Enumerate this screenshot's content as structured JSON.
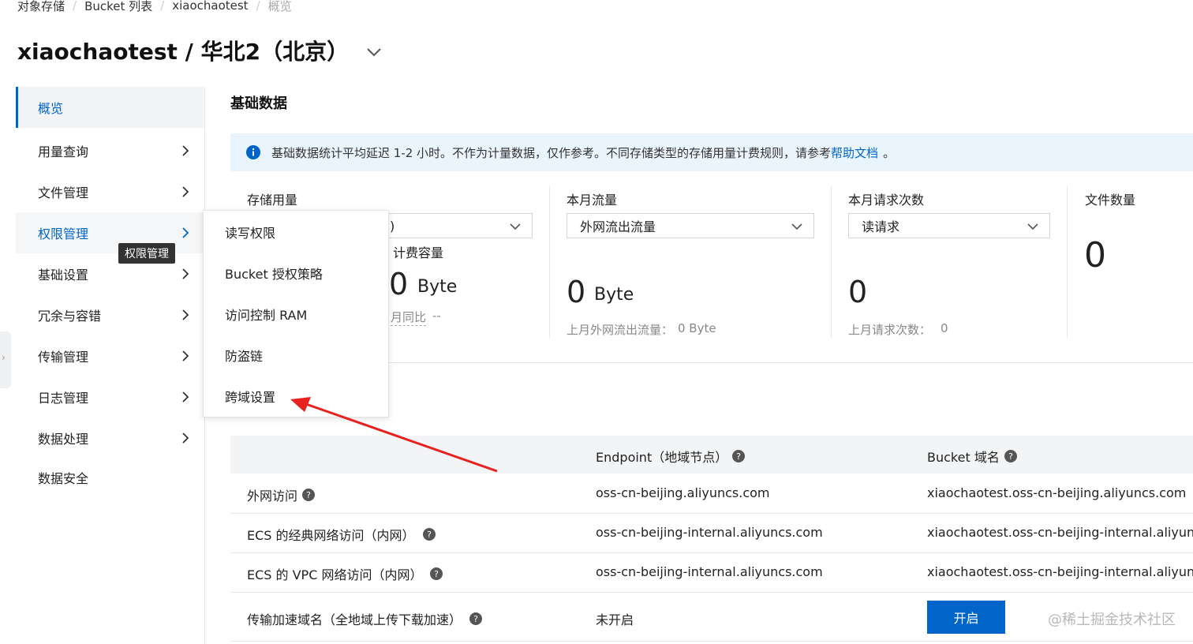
{
  "breadcrumb": [
    "对象存储",
    "Bucket 列表",
    "xiaochaotest",
    "概览"
  ],
  "title": "xiaochaotest / 华北2（北京）",
  "sidebar": {
    "items": [
      {
        "label": "概览",
        "active": true
      },
      {
        "label": "用量查询"
      },
      {
        "label": "文件管理"
      },
      {
        "label": "权限管理",
        "hovered": true
      },
      {
        "label": "基础设置"
      },
      {
        "label": "冗余与容错"
      },
      {
        "label": "传输管理"
      },
      {
        "label": "日志管理"
      },
      {
        "label": "数据处理"
      },
      {
        "label": "数据安全"
      }
    ],
    "tooltip": "权限管理"
  },
  "submenu": {
    "items": [
      "读写权限",
      "Bucket 授权策略",
      "访问控制 RAM",
      "防盗链",
      "跨域设置"
    ]
  },
  "basic": {
    "title": "基础数据",
    "notice_text": "基础数据统计平均延迟 1-2 小时。不作为计量数据，仅作参考。不同存储类型的存储用量计费规则，请参考",
    "notice_link": "帮助文档",
    "notice_end": "。",
    "storage": {
      "label": "存储用量",
      "select_partial": ")",
      "sub_label": "计费容量",
      "value": "0",
      "unit": "Byte",
      "compare": "月同比",
      "compare_value": "--"
    },
    "traffic": {
      "label": "本月流量",
      "select": "外网流出流量",
      "value": "0",
      "unit": "Byte",
      "last_month": "上月外网流出流量：",
      "last_month_value": "0 Byte"
    },
    "requests": {
      "label": "本月请求次数",
      "select": "读请求",
      "value": "0",
      "last_month": "上月请求次数：",
      "last_month_value": "0"
    },
    "files": {
      "label": "文件数量",
      "value": "0"
    }
  },
  "domain_table": {
    "headers": [
      "",
      "Endpoint（地域节点）",
      "Bucket 域名"
    ],
    "rows": [
      {
        "name": "外网访问",
        "endpoint": "oss-cn-beijing.aliyuncs.com",
        "domain": "xiaochaotest.oss-cn-beijing.aliyuncs.com"
      },
      {
        "name": "ECS 的经典网络访问（内网）",
        "endpoint": "oss-cn-beijing-internal.aliyuncs.com",
        "domain": "xiaochaotest.oss-cn-beijing-internal.aliyuncs."
      },
      {
        "name": "ECS 的 VPC 网络访问（内网）",
        "endpoint": "oss-cn-beijing-internal.aliyuncs.com",
        "domain": "xiaochaotest.oss-cn-beijing-internal.aliyuncs."
      },
      {
        "name": "传输加速域名（全地域上传下载加速）",
        "endpoint": "未开启",
        "button": "开启"
      }
    ]
  },
  "watermark": "@稀土掘金技术社区",
  "colors": {
    "accent": "#0064c8",
    "notice_bg": "#eaf4fd",
    "annotation_arrow": "#e8211f"
  }
}
